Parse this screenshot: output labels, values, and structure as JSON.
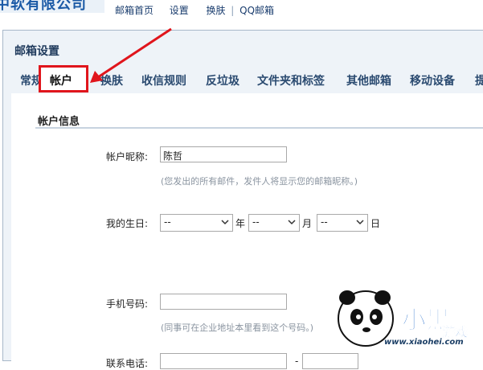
{
  "logo": {
    "text": "中软有限公司"
  },
  "nav": {
    "items": [
      "邮箱首页",
      "设置",
      "换肤",
      "QQ邮箱"
    ],
    "sep": "|"
  },
  "panel": {
    "title": "邮箱设置"
  },
  "tabs": [
    "常规",
    "帐户",
    "换肤",
    "收信规则",
    "反垃圾",
    "文件夹和标签",
    "其他邮箱",
    "移动设备",
    "提"
  ],
  "section": {
    "title": "帐户信息"
  },
  "form": {
    "nickname_label": "帐户昵称:",
    "nickname_value": "陈哲",
    "nickname_hint": "(您发出的所有邮件，发件人将显示您的邮箱昵称。)",
    "birthday_label": "我的生日:",
    "birthday_year": "--",
    "birthday_month": "--",
    "birthday_day": "--",
    "year_unit": "年",
    "month_unit": "月",
    "day_unit": "日",
    "mobile_label": "手机号码:",
    "mobile_value": "",
    "mobile_hint": "(同事可在企业地址本里看到这个号码。)",
    "phone_label": "联系电话:",
    "phone_sep": "-"
  },
  "watermark": {
    "site": "www.xiaohei.com",
    "brand": "小黑游戏"
  },
  "colors": {
    "highlight": "#e0151c",
    "nav_text": "#1a3d6e",
    "tab_text": "#2a4a70"
  }
}
